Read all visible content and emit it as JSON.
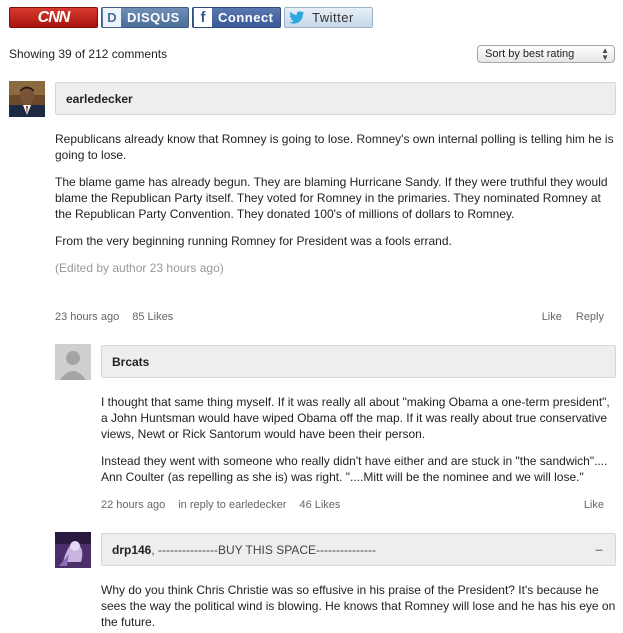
{
  "login": {
    "cnn_label": "CNN",
    "disqus_label": "DISQUS",
    "facebook_label": "Connect",
    "twitter_label": "Twitter"
  },
  "thread": {
    "count_text": "Showing 39 of 212 comments",
    "sort_value": "Sort by best rating"
  },
  "comments": [
    {
      "author": "earledecker",
      "paragraphs": [
        "Republicans already know that Romney is going to lose. Romney's own internal polling is telling him he is going to lose.",
        "The blame game has already begun. They are blaming Hurricane Sandy. If they were truthful they would blame the Republican Party itself. They voted for Romney in the primaries. They nominated Romney at the Republican Party Convention. They donated 100's of millions of dollars to Romney.",
        "From the very beginning running Romney for President was a fools errand."
      ],
      "edited_note": "(Edited by author 23 hours ago)",
      "time": "23 hours ago",
      "likes": "85 Likes",
      "like_label": "Like",
      "reply_label": "Reply"
    },
    {
      "author": "Brcats",
      "paragraphs": [
        " I thought that same thing myself.  If it was really all about \"making Obama a one-term president\", a John Huntsman would have wiped Obama off the map.  If it was really about true conservative views, Newt or Rick Santorum would have been their person.",
        "Instead they went with someone who really didn't have either and are stuck in \"the sandwich\".... Ann Coulter (as repelling as she is) was right.  \"....Mitt will be the nominee and we will lose.\""
      ],
      "time": "22 hours ago",
      "in_reply_to": "in reply to earledecker",
      "likes": "46 Likes",
      "like_label": "Like"
    },
    {
      "author": "drp146",
      "signature": ", ---------------BUY THIS SPACE---------------",
      "collapse_symbol": "–",
      "paragraphs": [
        "Why do you think Chris Christie was so effusive in his praise of the President? It's because he sees the way the political wind is blowing. He knows that Romney will lose and he has his eye on the future."
      ]
    }
  ]
}
